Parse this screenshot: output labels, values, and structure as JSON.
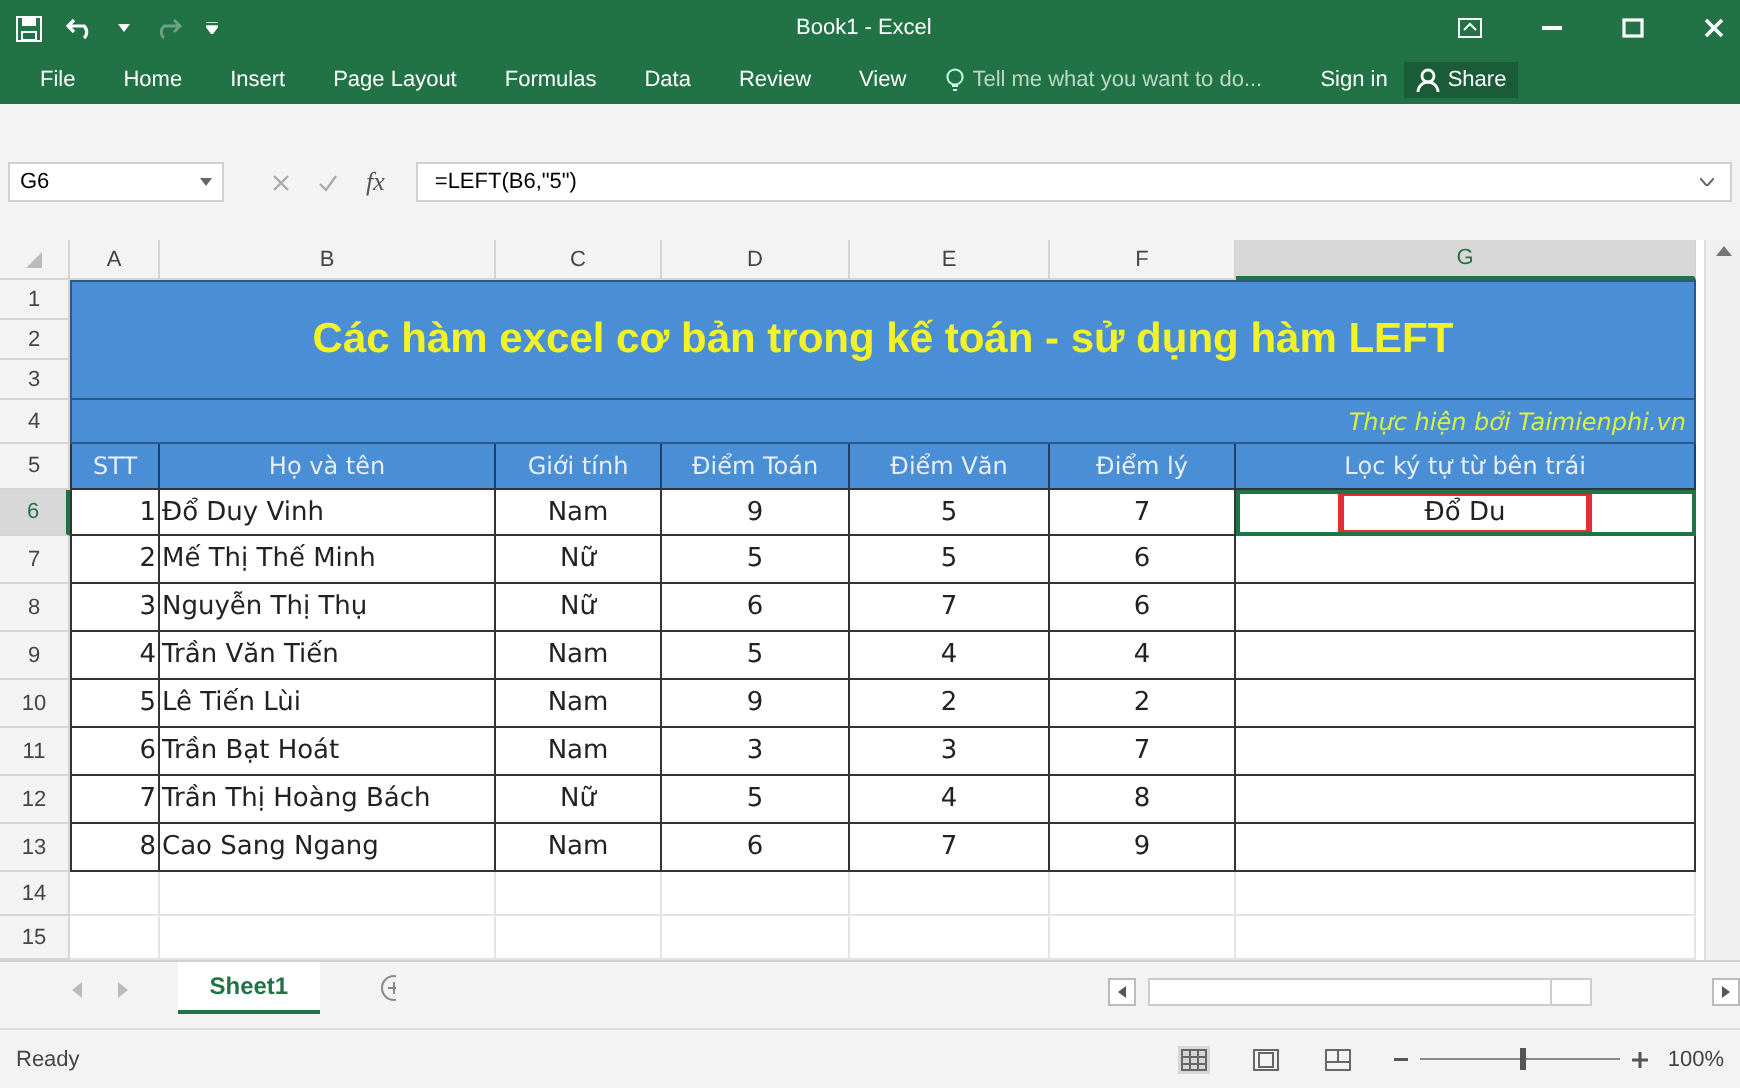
{
  "window": {
    "title": "Book1 - Excel"
  },
  "ribbon": {
    "tabs": [
      {
        "label": "File",
        "selected": false
      },
      {
        "label": "Home",
        "selected": false
      },
      {
        "label": "Insert",
        "selected": false
      },
      {
        "label": "Page Layout",
        "selected": false
      },
      {
        "label": "Formulas",
        "selected": false
      },
      {
        "label": "Data",
        "selected": false
      },
      {
        "label": "Review",
        "selected": false
      },
      {
        "label": "View",
        "selected": false
      }
    ],
    "tell_me": {
      "placeholder": "Tell me what you want to do..."
    },
    "sign_in": "Sign in",
    "share": "Share"
  },
  "formula_bar": {
    "name_box": "G6",
    "fx": "fx",
    "formula": "=LEFT(B6,\"5\")"
  },
  "columns": [
    {
      "label": "A",
      "selected": false
    },
    {
      "label": "B",
      "selected": false
    },
    {
      "label": "C",
      "selected": false
    },
    {
      "label": "D",
      "selected": false
    },
    {
      "label": "E",
      "selected": false
    },
    {
      "label": "F",
      "selected": false
    },
    {
      "label": "G",
      "selected": true
    }
  ],
  "rows": [
    {
      "label": "1",
      "selected": false
    },
    {
      "label": "2",
      "selected": false
    },
    {
      "label": "3",
      "selected": false
    },
    {
      "label": "4",
      "selected": false
    },
    {
      "label": "5",
      "selected": false
    },
    {
      "label": "6",
      "selected": true
    },
    {
      "label": "7",
      "selected": false
    },
    {
      "label": "8",
      "selected": false
    },
    {
      "label": "9",
      "selected": false
    },
    {
      "label": "10",
      "selected": false
    },
    {
      "label": "11",
      "selected": false
    },
    {
      "label": "12",
      "selected": false
    },
    {
      "label": "13",
      "selected": false
    },
    {
      "label": "14",
      "selected": false
    },
    {
      "label": "15",
      "selected": false
    }
  ],
  "sheet": {
    "title": "Các hàm excel cơ bản trong kế toán - sử dụng hàm LEFT",
    "credit": "Thực hiện bởi Taimienphi.vn",
    "headers": [
      "STT",
      "Họ và tên",
      "Giới tính",
      "Điểm Toán",
      "Điểm Văn",
      "Điểm lý",
      "Lọc ký tự từ bên trái"
    ],
    "records": [
      {
        "cells": [
          "1",
          "Đổ Duy Vinh",
          "Nam",
          "9",
          "5",
          "7"
        ],
        "result": {
          "text": "Đổ Du",
          "annotated": true
        },
        "selected": true
      },
      {
        "cells": [
          "2",
          "Mế Thị Thế Minh",
          "Nữ",
          "5",
          "5",
          "6"
        ],
        "selected": false
      },
      {
        "cells": [
          "3",
          "Nguyễn Thị Thụ",
          "Nữ",
          "6",
          "7",
          "6"
        ],
        "selected": false
      },
      {
        "cells": [
          "4",
          "Trần Văn Tiến",
          "Nam",
          "5",
          "4",
          "4"
        ],
        "selected": false
      },
      {
        "cells": [
          "5",
          "Lê Tiến Lùi",
          "Nam",
          "9",
          "2",
          "2"
        ],
        "selected": false
      },
      {
        "cells": [
          "6",
          "Trần Bạt Hoát",
          "Nam",
          "3",
          "3",
          "7"
        ],
        "selected": false
      },
      {
        "cells": [
          "7",
          "Trần Thị Hoàng Bách",
          "Nữ",
          "5",
          "4",
          "8"
        ],
        "selected": false
      },
      {
        "cells": [
          "8",
          "Cao Sang Ngang",
          "Nam",
          "6",
          "7",
          "9"
        ],
        "selected": false
      }
    ]
  },
  "sheet_tabs": [
    {
      "label": "Sheet1",
      "selected": true
    }
  ],
  "status_bar": {
    "text": "Ready",
    "views": [
      {
        "kind": "normal",
        "selected": true
      },
      {
        "kind": "page-layout",
        "selected": false
      },
      {
        "kind": "page-break",
        "selected": false
      }
    ],
    "zoom_slider": {
      "level": 0.5
    },
    "zoom": "100%"
  }
}
